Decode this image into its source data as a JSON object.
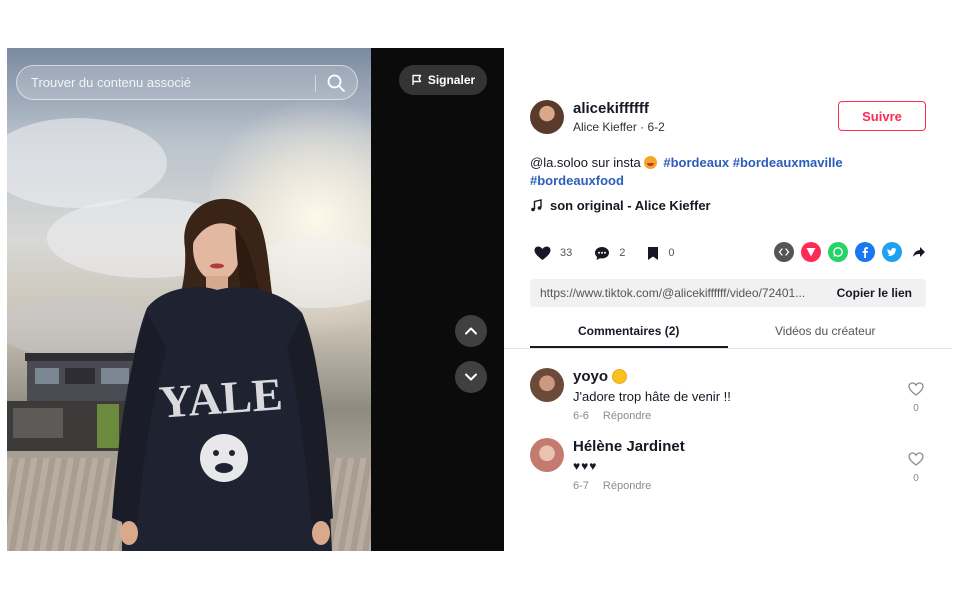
{
  "video": {
    "search_placeholder": "Trouver du contenu associé",
    "report_label": "Signaler"
  },
  "author": {
    "username": "alicekiffffff",
    "display_name": "Alice Kieffer",
    "date": "6-2",
    "sub_line": "Alice Kieffer · 6-2",
    "follow_label": "Suivre"
  },
  "caption": {
    "text_before_emoji": "@la.soloo sur insta",
    "hashtags": [
      "#bordeaux",
      "#bordeauxmaville",
      "#bordeauxfood"
    ]
  },
  "music": {
    "label": "son original - Alice Kieffer"
  },
  "stats": {
    "likes": "33",
    "comments": "2",
    "saves": "0"
  },
  "share_icons": [
    "embed-icon",
    "send-icon",
    "whatsapp-icon",
    "facebook-icon",
    "twitter-icon",
    "forward-icon"
  ],
  "colors": {
    "accent": "#fe2c55",
    "hashtag": "#2b5db9",
    "whatsapp": "#25d366",
    "facebook": "#1877f2",
    "twitter": "#1da1f2",
    "embed": "#555555"
  },
  "link": {
    "url": "https://www.tiktok.com/@alicekiffffff/video/72401...",
    "copy_label": "Copier le lien"
  },
  "tabs": {
    "comments_label": "Commentaires (2)",
    "videos_label": "Vidéos du créateur"
  },
  "comments": [
    {
      "name": "yoyo",
      "text": "J'adore trop hâte de venir !!",
      "date": "6-6",
      "reply_label": "Répondre",
      "likes": "0"
    },
    {
      "name": "Hélène Jardinet",
      "text": "♥♥♥",
      "date": "6-7",
      "reply_label": "Répondre",
      "likes": "0"
    }
  ]
}
